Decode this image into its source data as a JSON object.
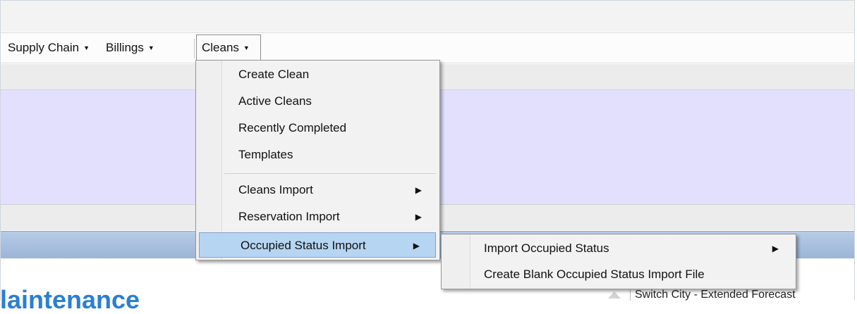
{
  "menubar": {
    "items": [
      {
        "label": "Supply Chain"
      },
      {
        "label": "Billings"
      },
      {
        "label": "Cleans"
      }
    ]
  },
  "cleans_menu": {
    "items": [
      {
        "label": "Create Clean"
      },
      {
        "label": "Active Cleans"
      },
      {
        "label": "Recently Completed"
      },
      {
        "label": "Templates"
      },
      {
        "label": "Cleans Import"
      },
      {
        "label": "Reservation Import"
      },
      {
        "label": "Occupied Status Import"
      }
    ]
  },
  "occupied_submenu": {
    "items": [
      {
        "label": "Import Occupied Status"
      },
      {
        "label": "Create Blank Occupied Status Import File"
      }
    ]
  },
  "page": {
    "section_title": "laintenance"
  },
  "side_panel": {
    "title": "Switch City - Extended Forecast"
  },
  "colors": {
    "highlight": "#b6d5f2",
    "lavender_band": "#e2e0fc",
    "blue_bar": "#9bb5d8",
    "title_blue": "#2a7fd2"
  }
}
